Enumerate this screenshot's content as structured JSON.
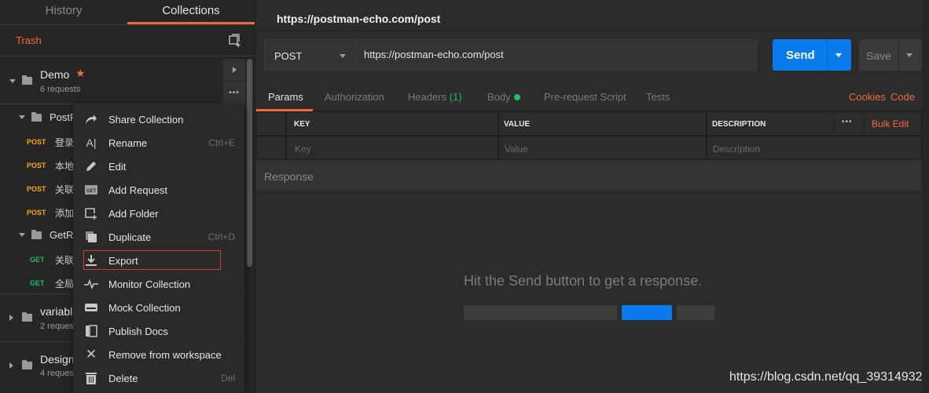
{
  "sidebar": {
    "tabs": [
      "History",
      "Collections"
    ],
    "trash_label": "Trash",
    "collections": [
      {
        "name": "Demo",
        "sub": "6 requests"
      },
      {
        "name": "variable",
        "sub": "2 reques"
      },
      {
        "name": "Design",
        "sub": "4 reques"
      }
    ],
    "folders": [
      {
        "name": "PostR"
      },
      {
        "name": "GetRe"
      }
    ],
    "requests": [
      {
        "method": "POST",
        "name": "登录"
      },
      {
        "method": "POST",
        "name": "本地"
      },
      {
        "method": "POST",
        "name": "关联"
      },
      {
        "method": "POST",
        "name": "添加"
      },
      {
        "method": "GET",
        "name": "关联"
      },
      {
        "method": "GET",
        "name": "全局"
      }
    ]
  },
  "context_menu": {
    "items": [
      {
        "label": "Share Collection",
        "shortcut": "",
        "icon": "share-icon"
      },
      {
        "label": "Rename",
        "shortcut": "Ctrl+E",
        "icon": "rename-icon"
      },
      {
        "label": "Edit",
        "shortcut": "",
        "icon": "pencil-icon"
      },
      {
        "label": "Add Request",
        "shortcut": "",
        "icon": "get-request-icon"
      },
      {
        "label": "Add Folder",
        "shortcut": "",
        "icon": "add-folder-icon"
      },
      {
        "label": "Duplicate",
        "shortcut": "Ctrl+D",
        "icon": "duplicate-icon"
      },
      {
        "label": "Export",
        "shortcut": "",
        "icon": "download-icon"
      },
      {
        "label": "Monitor Collection",
        "shortcut": "",
        "icon": "pulse-icon"
      },
      {
        "label": "Mock Collection",
        "shortcut": "",
        "icon": "server-icon"
      },
      {
        "label": "Publish Docs",
        "shortcut": "",
        "icon": "docs-icon"
      },
      {
        "label": "Remove from workspace",
        "shortcut": "",
        "icon": "close-icon"
      },
      {
        "label": "Delete",
        "shortcut": "Del",
        "icon": "trash-icon"
      }
    ]
  },
  "main": {
    "tab_title": "https://postman-echo.com/post",
    "method": "POST",
    "url": "https://postman-echo.com/post",
    "send_label": "Send",
    "save_label": "Save",
    "sub_tabs": {
      "params": "Params",
      "authorization": "Authorization",
      "headers": "Headers",
      "headers_count": "(1)",
      "body": "Body",
      "pre_request": "Pre-request Script",
      "tests": "Tests",
      "cookies": "Cookies",
      "code": "Code"
    },
    "params_table": {
      "headers": [
        "KEY",
        "VALUE",
        "DESCRIPTION"
      ],
      "placeholders": [
        "Key",
        "Value",
        "Description"
      ],
      "bulk_edit": "Bulk Edit",
      "more": "•••"
    },
    "response_label": "Response",
    "hint": "Hit the Send button to get a response."
  },
  "watermark": "https://blog.csdn.net/qq_39314932",
  "colors": {
    "accent": "#f26b3a",
    "send": "#097bed",
    "post": "#f5a623",
    "get": "#1fbf6a"
  }
}
